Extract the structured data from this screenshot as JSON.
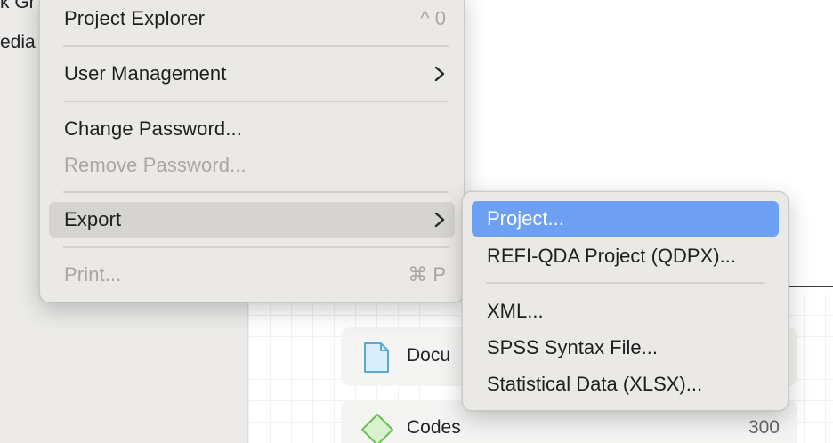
{
  "sidebar": {
    "items": [
      {
        "label": "k Gr"
      },
      {
        "label": "edia"
      }
    ]
  },
  "cards": [
    {
      "label": "Docu",
      "icon": "document-icon",
      "count": ""
    },
    {
      "label": "Codes",
      "icon": "code-diamond-icon",
      "count": "300"
    }
  ],
  "menu": {
    "project_explorer": {
      "label": "Project Explorer",
      "shortcut": "^ 0"
    },
    "user_management": {
      "label": "User Management"
    },
    "change_password": {
      "label": "Change Password..."
    },
    "remove_password": {
      "label": "Remove Password..."
    },
    "export": {
      "label": "Export"
    },
    "print": {
      "label": "Print...",
      "shortcut": "⌘ P"
    }
  },
  "export_submenu": {
    "items": [
      {
        "label": "Project..."
      },
      {
        "label": "REFI-QDA Project (QDPX)..."
      },
      {
        "label": "XML..."
      },
      {
        "label": "SPSS Syntax File..."
      },
      {
        "label": "Statistical Data (XLSX)..."
      }
    ]
  },
  "colors": {
    "menu_bg": "#ebe9e6",
    "hover": "#d6d4d1",
    "selection": "#6d9ff2",
    "disabled_text": "#a9a7a4"
  }
}
